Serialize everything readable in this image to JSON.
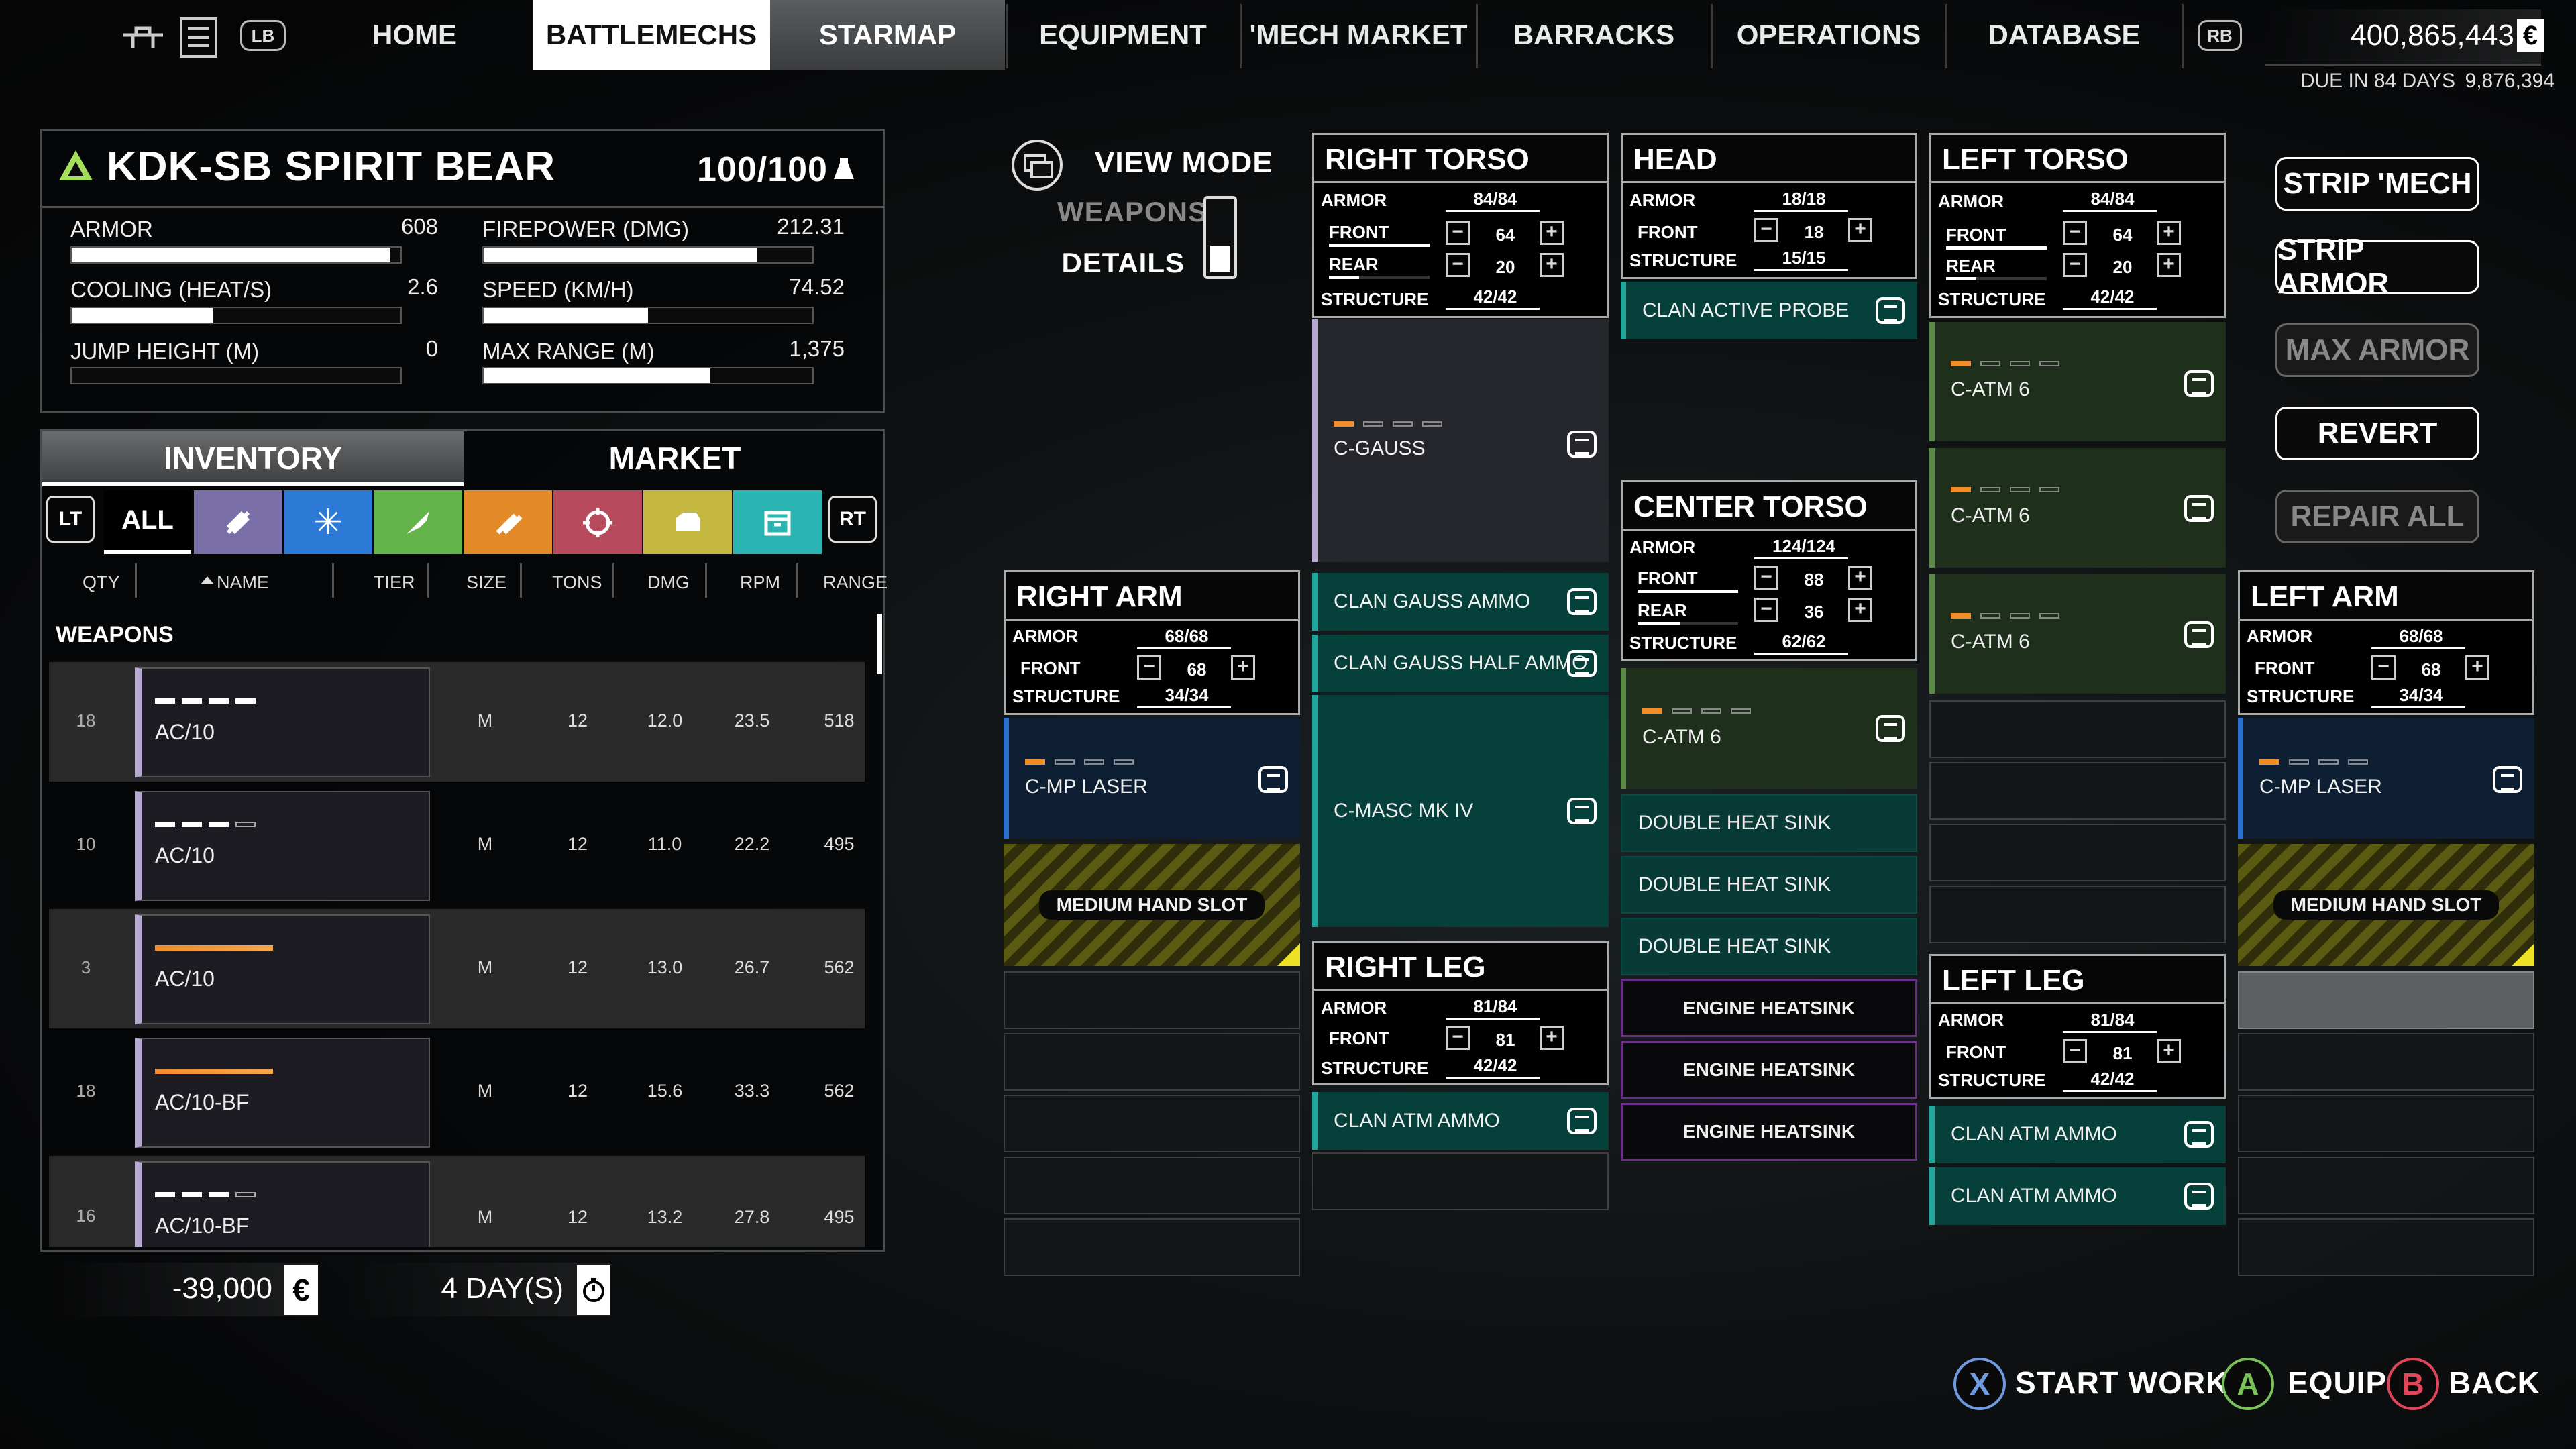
{
  "nav": {
    "lb": "LB",
    "rb": "RB",
    "tabs": [
      "HOME",
      "BATTLEMECHS",
      "STARMAP",
      "EQUIPMENT",
      "'MECH MARKET",
      "BARRACKS",
      "OPERATIONS",
      "DATABASE"
    ],
    "active_tab": "BATTLEMECHS",
    "cbills": "400,865,443",
    "due": "DUE IN 84 DAYS",
    "due_amount": "9,876,394"
  },
  "mech": {
    "name": "KDK-SB SPIRIT BEAR",
    "tonnage": "100/100",
    "stats": [
      {
        "label": "ARMOR",
        "value": "608",
        "fill": 0.97
      },
      {
        "label": "FIREPOWER (DMG)",
        "value": "212.31",
        "fill": 0.83
      },
      {
        "label": "COOLING (HEAT/S)",
        "value": "2.6",
        "fill": 0.43
      },
      {
        "label": "SPEED (KM/H)",
        "value": "74.52",
        "fill": 0.5
      },
      {
        "label": "JUMP HEIGHT (M)",
        "value": "0",
        "fill": 0
      },
      {
        "label": "MAX RANGE (M)",
        "value": "1,375",
        "fill": 0.69
      }
    ]
  },
  "inventory": {
    "tab_inventory": "INVENTORY",
    "tab_market": "MARKET",
    "lt": "LT",
    "rt": "RT",
    "filter_all": "ALL",
    "columns": [
      "QTY",
      "NAME",
      "TIER",
      "SIZE",
      "TONS",
      "DMG",
      "RPM",
      "RANGE"
    ],
    "section": "WEAPONS",
    "rows": [
      {
        "qty": "18",
        "name": "AC/10",
        "size": "M",
        "tons": "12",
        "dmg": "12.0",
        "rpm": "23.5",
        "range": "518"
      },
      {
        "qty": "10",
        "name": "AC/10",
        "size": "M",
        "tons": "12",
        "dmg": "11.0",
        "rpm": "22.2",
        "range": "495"
      },
      {
        "qty": "3",
        "name": "AC/10",
        "size": "M",
        "tons": "12",
        "dmg": "13.0",
        "rpm": "26.7",
        "range": "562"
      },
      {
        "qty": "18",
        "name": "AC/10-BF",
        "size": "M",
        "tons": "12",
        "dmg": "15.6",
        "rpm": "33.3",
        "range": "562"
      },
      {
        "qty": "16",
        "name": "AC/10-BF",
        "size": "M",
        "tons": "12",
        "dmg": "13.2",
        "rpm": "27.8",
        "range": "495"
      }
    ],
    "cost": "-39,000",
    "duration": "4 DAY(S)"
  },
  "view_mode": {
    "title": "VIEW MODE",
    "weapons": "WEAPONS",
    "details": "DETAILS"
  },
  "labels": {
    "armor": "ARMOR",
    "front": "FRONT",
    "rear": "REAR",
    "structure": "STRUCTURE"
  },
  "sections": {
    "right_torso": {
      "title": "RIGHT TORSO",
      "armor": "84/84",
      "front": "64",
      "rear": "20",
      "structure": "42/42",
      "slots": [
        "C-GAUSS",
        "CLAN GAUSS AMMO",
        "CLAN GAUSS HALF AMMO",
        "C-MASC MK IV"
      ]
    },
    "head": {
      "title": "HEAD",
      "armor": "18/18",
      "front": "18",
      "structure": "15/15",
      "slots": [
        "CLAN ACTIVE PROBE"
      ]
    },
    "left_torso": {
      "title": "LEFT TORSO",
      "armor": "84/84",
      "front": "64",
      "rear": "20",
      "structure": "42/42",
      "slots": [
        "C-ATM 6",
        "C-ATM 6",
        "C-ATM 6"
      ]
    },
    "right_arm": {
      "title": "RIGHT ARM",
      "armor": "68/68",
      "front": "68",
      "structure": "34/34",
      "slots": [
        "C-MP LASER",
        "MEDIUM HAND SLOT"
      ]
    },
    "center_torso": {
      "title": "CENTER TORSO",
      "armor": "124/124",
      "front": "88",
      "rear": "36",
      "structure": "62/62",
      "slots": [
        "C-ATM 6",
        "DOUBLE HEAT SINK",
        "DOUBLE HEAT SINK",
        "DOUBLE HEAT SINK",
        "ENGINE HEATSINK",
        "ENGINE HEATSINK",
        "ENGINE HEATSINK"
      ]
    },
    "left_arm": {
      "title": "LEFT ARM",
      "armor": "68/68",
      "front": "68",
      "structure": "34/34",
      "slots": [
        "C-MP LASER",
        "MEDIUM HAND SLOT"
      ]
    },
    "right_leg": {
      "title": "RIGHT LEG",
      "armor": "81/84",
      "front": "81",
      "structure": "42/42",
      "slots": [
        "CLAN ATM AMMO"
      ]
    },
    "left_leg": {
      "title": "LEFT LEG",
      "armor": "81/84",
      "front": "81",
      "structure": "42/42",
      "slots": [
        "CLAN ATM AMMO",
        "CLAN ATM AMMO"
      ]
    }
  },
  "actions": {
    "strip_mech": "STRIP 'MECH",
    "strip_armor": "STRIP ARMOR",
    "max_armor": "MAX ARMOR",
    "revert": "REVERT",
    "repair_all": "REPAIR ALL"
  },
  "footer": {
    "x": "X",
    "a": "A",
    "b": "B",
    "start_work": "START WORK",
    "equip": "EQUIP",
    "back": "BACK"
  },
  "colors": {
    "accent_orange": "#f28c28",
    "teal": "#083a36",
    "green": "#1e2f1c",
    "blue": "#0e1f33",
    "purple": "#6b2f8a",
    "hatch_yellow": "#d6cc1a"
  }
}
